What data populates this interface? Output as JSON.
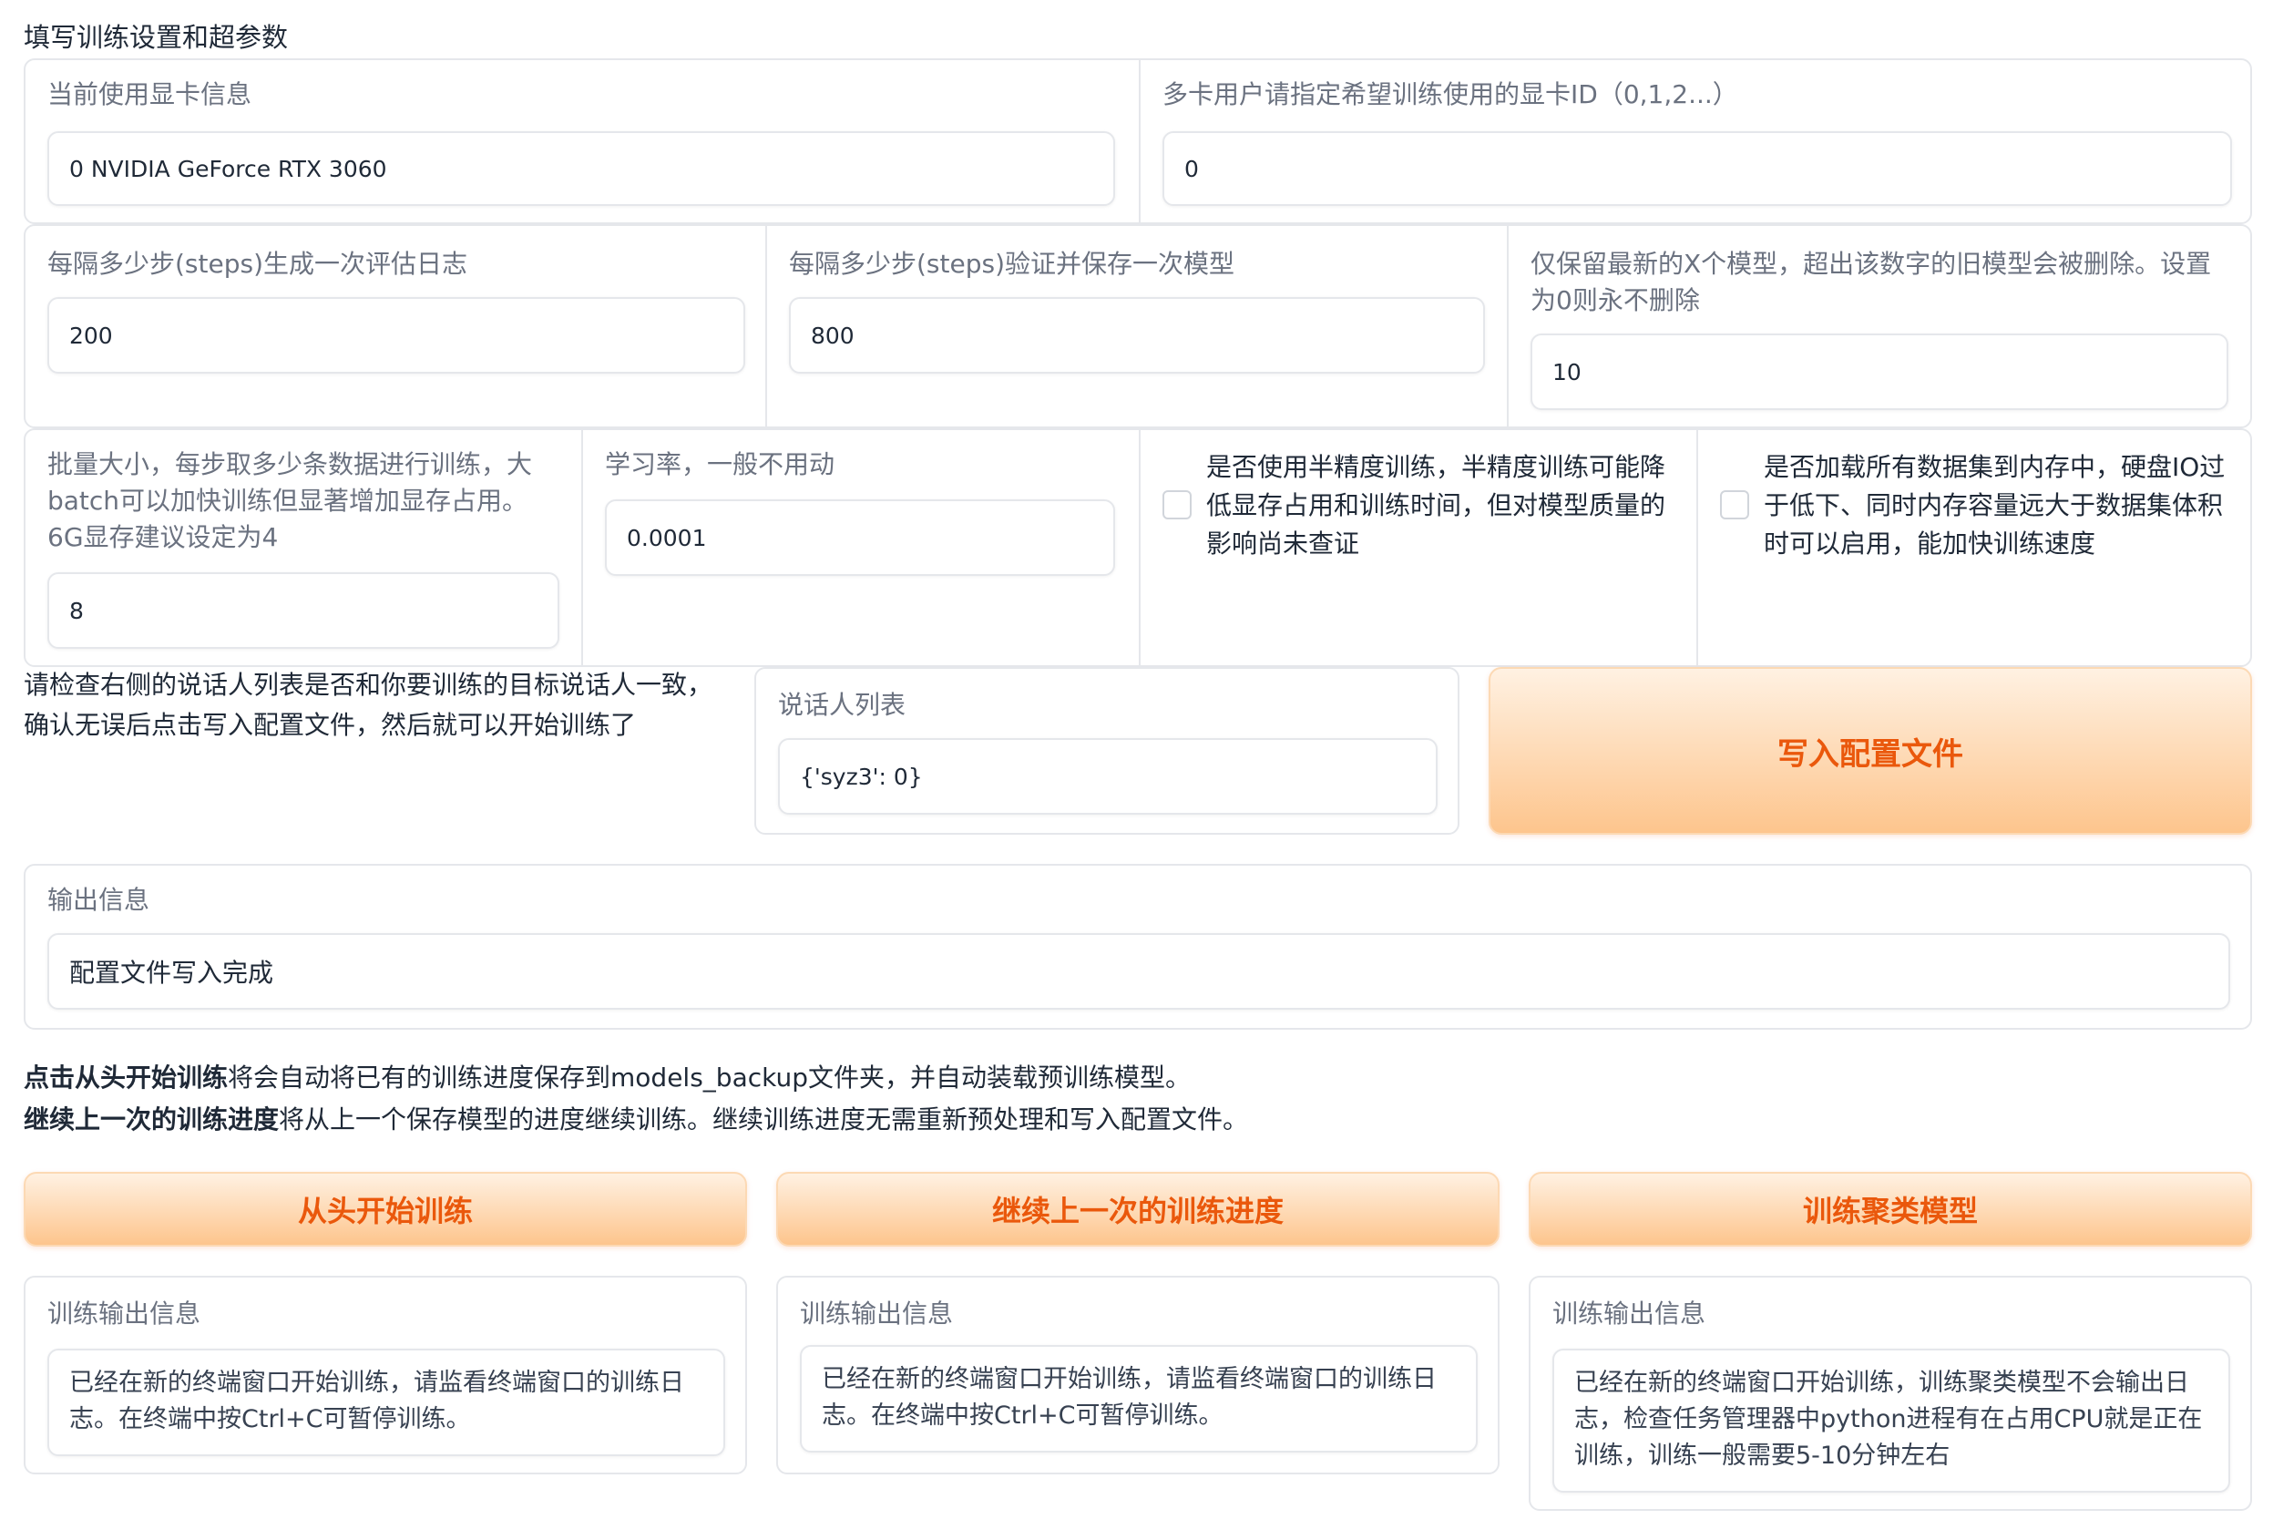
{
  "section_title": "填写训练设置和超参数",
  "gpu": {
    "label": "当前使用显卡信息",
    "value": "0 NVIDIA GeForce RTX 3060"
  },
  "gpu_id": {
    "label": "多卡用户请指定希望训练使用的显卡ID（0,1,2...）",
    "value": "0"
  },
  "log_interval": {
    "label": "每隔多少步(steps)生成一次评估日志",
    "value": "200"
  },
  "eval_interval": {
    "label": "每隔多少步(steps)验证并保存一次模型",
    "value": "800"
  },
  "keep_models": {
    "label": "仅保留最新的X个模型，超出该数字的旧模型会被删除。设置为0则永不删除",
    "value": "10"
  },
  "batch_size": {
    "label": "批量大小，每步取多少条数据进行训练，大batch可以加快训练但显著增加显存占用。6G显存建议设定为4",
    "value": "8"
  },
  "learning_rate": {
    "label": "学习率，一般不用动",
    "value": "0.0001"
  },
  "fp16": {
    "label": "是否使用半精度训练，半精度训练可能降低显存占用和训练时间，但对模型质量的影响尚未查证",
    "checked": false
  },
  "load_all_data": {
    "label": "是否加载所有数据集到内存中，硬盘IO过于低下、同时内存容量远大于数据集体积时可以启用，能加快训练速度",
    "checked": false
  },
  "check_hint": "请检查右侧的说话人列表是否和你要训练的目标说话人一致，确认无误后点击写入配置文件，然后就可以开始训练了",
  "speakers": {
    "label": "说话人列表",
    "value": "{'syz3': 0}"
  },
  "write_config_button": "写入配置文件",
  "output": {
    "label": "输出信息",
    "value": "配置文件写入完成"
  },
  "notes": {
    "line1_bold": "点击从头开始训练",
    "line1_rest": "将会自动将已有的训练进度保存到models_backup文件夹，并自动装载预训练模型。",
    "line2_bold": "继续上一次的训练进度",
    "line2_rest": "将从上一个保存模型的进度继续训练。继续训练进度无需重新预处理和写入配置文件。"
  },
  "buttons": {
    "train_scratch": "从头开始训练",
    "train_continue": "继续上一次的训练进度",
    "train_cluster": "训练聚类模型"
  },
  "train_outputs": [
    {
      "label": "训练输出信息",
      "value": "已经在新的终端窗口开始训练，请监看终端窗口的训练日志。在终端中按Ctrl+C可暂停训练。"
    },
    {
      "label": "训练输出信息",
      "value": "已经在新的终端窗口开始训练，请监看终端窗口的训练日志。在终端中按Ctrl+C可暂停训练。"
    },
    {
      "label": "训练输出信息",
      "value": "已经在新的终端窗口开始训练，训练聚类模型不会输出日志，检查任务管理器中python进程有在占用CPU就是正在训练，训练一般需要5-10分钟左右"
    }
  ],
  "colors": {
    "accent": "#ea580c",
    "button_gradient_top": "#fff1e2",
    "button_gradient_bottom": "#fdc58d",
    "border": "#e5e7eb"
  }
}
